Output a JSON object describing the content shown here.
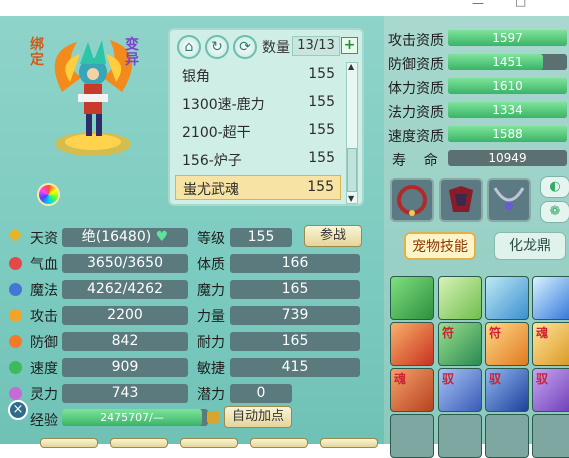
{
  "pet": {
    "bind_label": "绑定",
    "mutate_label": "变异"
  },
  "list": {
    "count_label": "数量",
    "count_value": "13/13",
    "items": [
      {
        "name": "银角",
        "value": "155"
      },
      {
        "name": "1300速-鹿力",
        "value": "155"
      },
      {
        "name": "2100-超干",
        "value": "155"
      },
      {
        "name": "156-炉子",
        "value": "155"
      },
      {
        "name": "蚩尤武魂",
        "value": "155"
      }
    ]
  },
  "stats": {
    "aptitude_label": "天资",
    "aptitude_value": "绝(16480)",
    "level_label": "等级",
    "level_value": "155",
    "fight_button": "参战",
    "hp_label": "气血",
    "hp_value": "3650/3650",
    "con_label": "体质",
    "con_value": "166",
    "mp_label": "魔法",
    "mp_value": "4262/4262",
    "mag_label": "魔力",
    "mag_value": "165",
    "atk_label": "攻击",
    "atk_value": "2200",
    "str_label": "力量",
    "str_value": "739",
    "def_label": "防御",
    "def_value": "842",
    "end_label": "耐力",
    "end_value": "165",
    "spd_label": "速度",
    "spd_value": "909",
    "agi_label": "敏捷",
    "agi_value": "415",
    "spi_label": "灵力",
    "spi_value": "743",
    "pot_label": "潜力",
    "pot_value": "0",
    "exp_label": "经验",
    "exp_value": "2475707/—",
    "auto_button": "自动加点"
  },
  "aptitudes": [
    {
      "label": "攻击资质",
      "value": "1597",
      "fill": 1.0
    },
    {
      "label": "防御资质",
      "value": "1451",
      "fill": 0.8
    },
    {
      "label": "体力资质",
      "value": "1610",
      "fill": 1.0
    },
    {
      "label": "法力资质",
      "value": "1334",
      "fill": 1.0
    },
    {
      "label": "速度资质",
      "value": "1588",
      "fill": 1.0
    },
    {
      "label": "寿    命",
      "value": "10949",
      "fill": 0
    }
  ],
  "tabs": {
    "skills": "宠物技能",
    "hualong": "化龙鼎"
  },
  "skill_marks": [
    "符",
    "符",
    "魂",
    "魂",
    "驭",
    "驭",
    "驭"
  ],
  "colors": {
    "panel": "#8fd3c9",
    "stat_box": "#5a7a7e",
    "bar_fill": "#39b467",
    "selected_row": "#f7e3a3"
  }
}
